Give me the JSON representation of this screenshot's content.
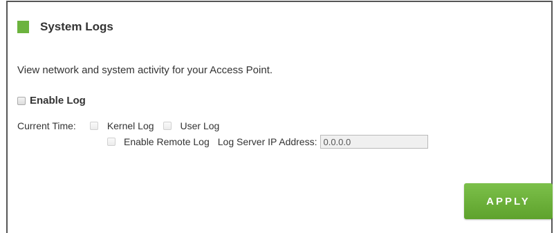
{
  "section": {
    "title": "System Logs",
    "description": "View network and system activity for your Access Point.",
    "accent_color": "#6cb33e"
  },
  "enable_log": {
    "label": "Enable Log",
    "checked": false
  },
  "log_options": {
    "current_time_label": "Current Time:",
    "kernel_log_label": "Kernel Log",
    "user_log_label": "User Log",
    "enable_remote_log_label": "Enable Remote Log",
    "log_server_ip_label": "Log Server IP Address:",
    "log_server_ip_value": "0.0.0.0"
  },
  "actions": {
    "apply_label": "APPLY",
    "apply_color": "#6cb33e"
  }
}
